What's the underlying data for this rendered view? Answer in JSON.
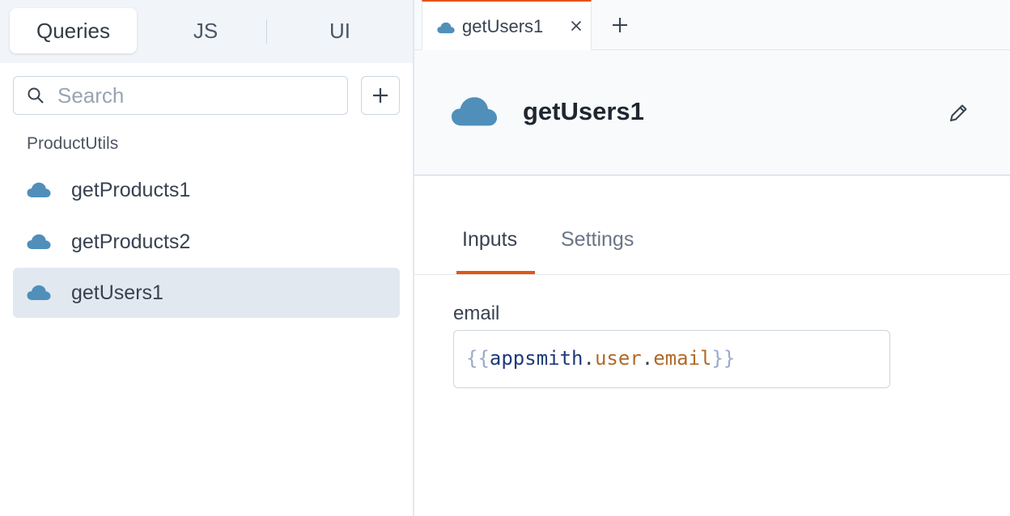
{
  "left_panel": {
    "segments": [
      {
        "label": "Queries",
        "active": true
      },
      {
        "label": "JS",
        "active": false
      },
      {
        "label": "UI",
        "active": false
      }
    ],
    "search": {
      "placeholder": "Search",
      "value": ""
    },
    "group_label": "ProductUtils",
    "items": [
      {
        "label": "getProducts1",
        "icon": "cloud-icon",
        "selected": false
      },
      {
        "label": "getProducts2",
        "icon": "cloud-icon",
        "selected": false
      },
      {
        "label": "getUsers1",
        "icon": "cloud-icon",
        "selected": true
      }
    ]
  },
  "editor": {
    "tabs": [
      {
        "label": "getUsers1",
        "icon": "cloud-icon",
        "active": true
      }
    ],
    "header": {
      "title": "getUsers1",
      "icon": "cloud-icon"
    },
    "subtabs": [
      {
        "label": "Inputs",
        "active": true
      },
      {
        "label": "Settings",
        "active": false
      }
    ],
    "inputs": [
      {
        "label": "email",
        "value": "{{appsmith.user.email}}",
        "tokens": {
          "open": "{{",
          "obj": "appsmith",
          "dot1": ".",
          "prop1": "user",
          "dot2": ".",
          "prop2": "email",
          "close": "}}"
        }
      }
    ]
  },
  "colors": {
    "accent": "#e15615",
    "cloud": "#4f8fba",
    "selected_bg": "#e2e8f0",
    "panel_bg": "#f8fafc"
  }
}
